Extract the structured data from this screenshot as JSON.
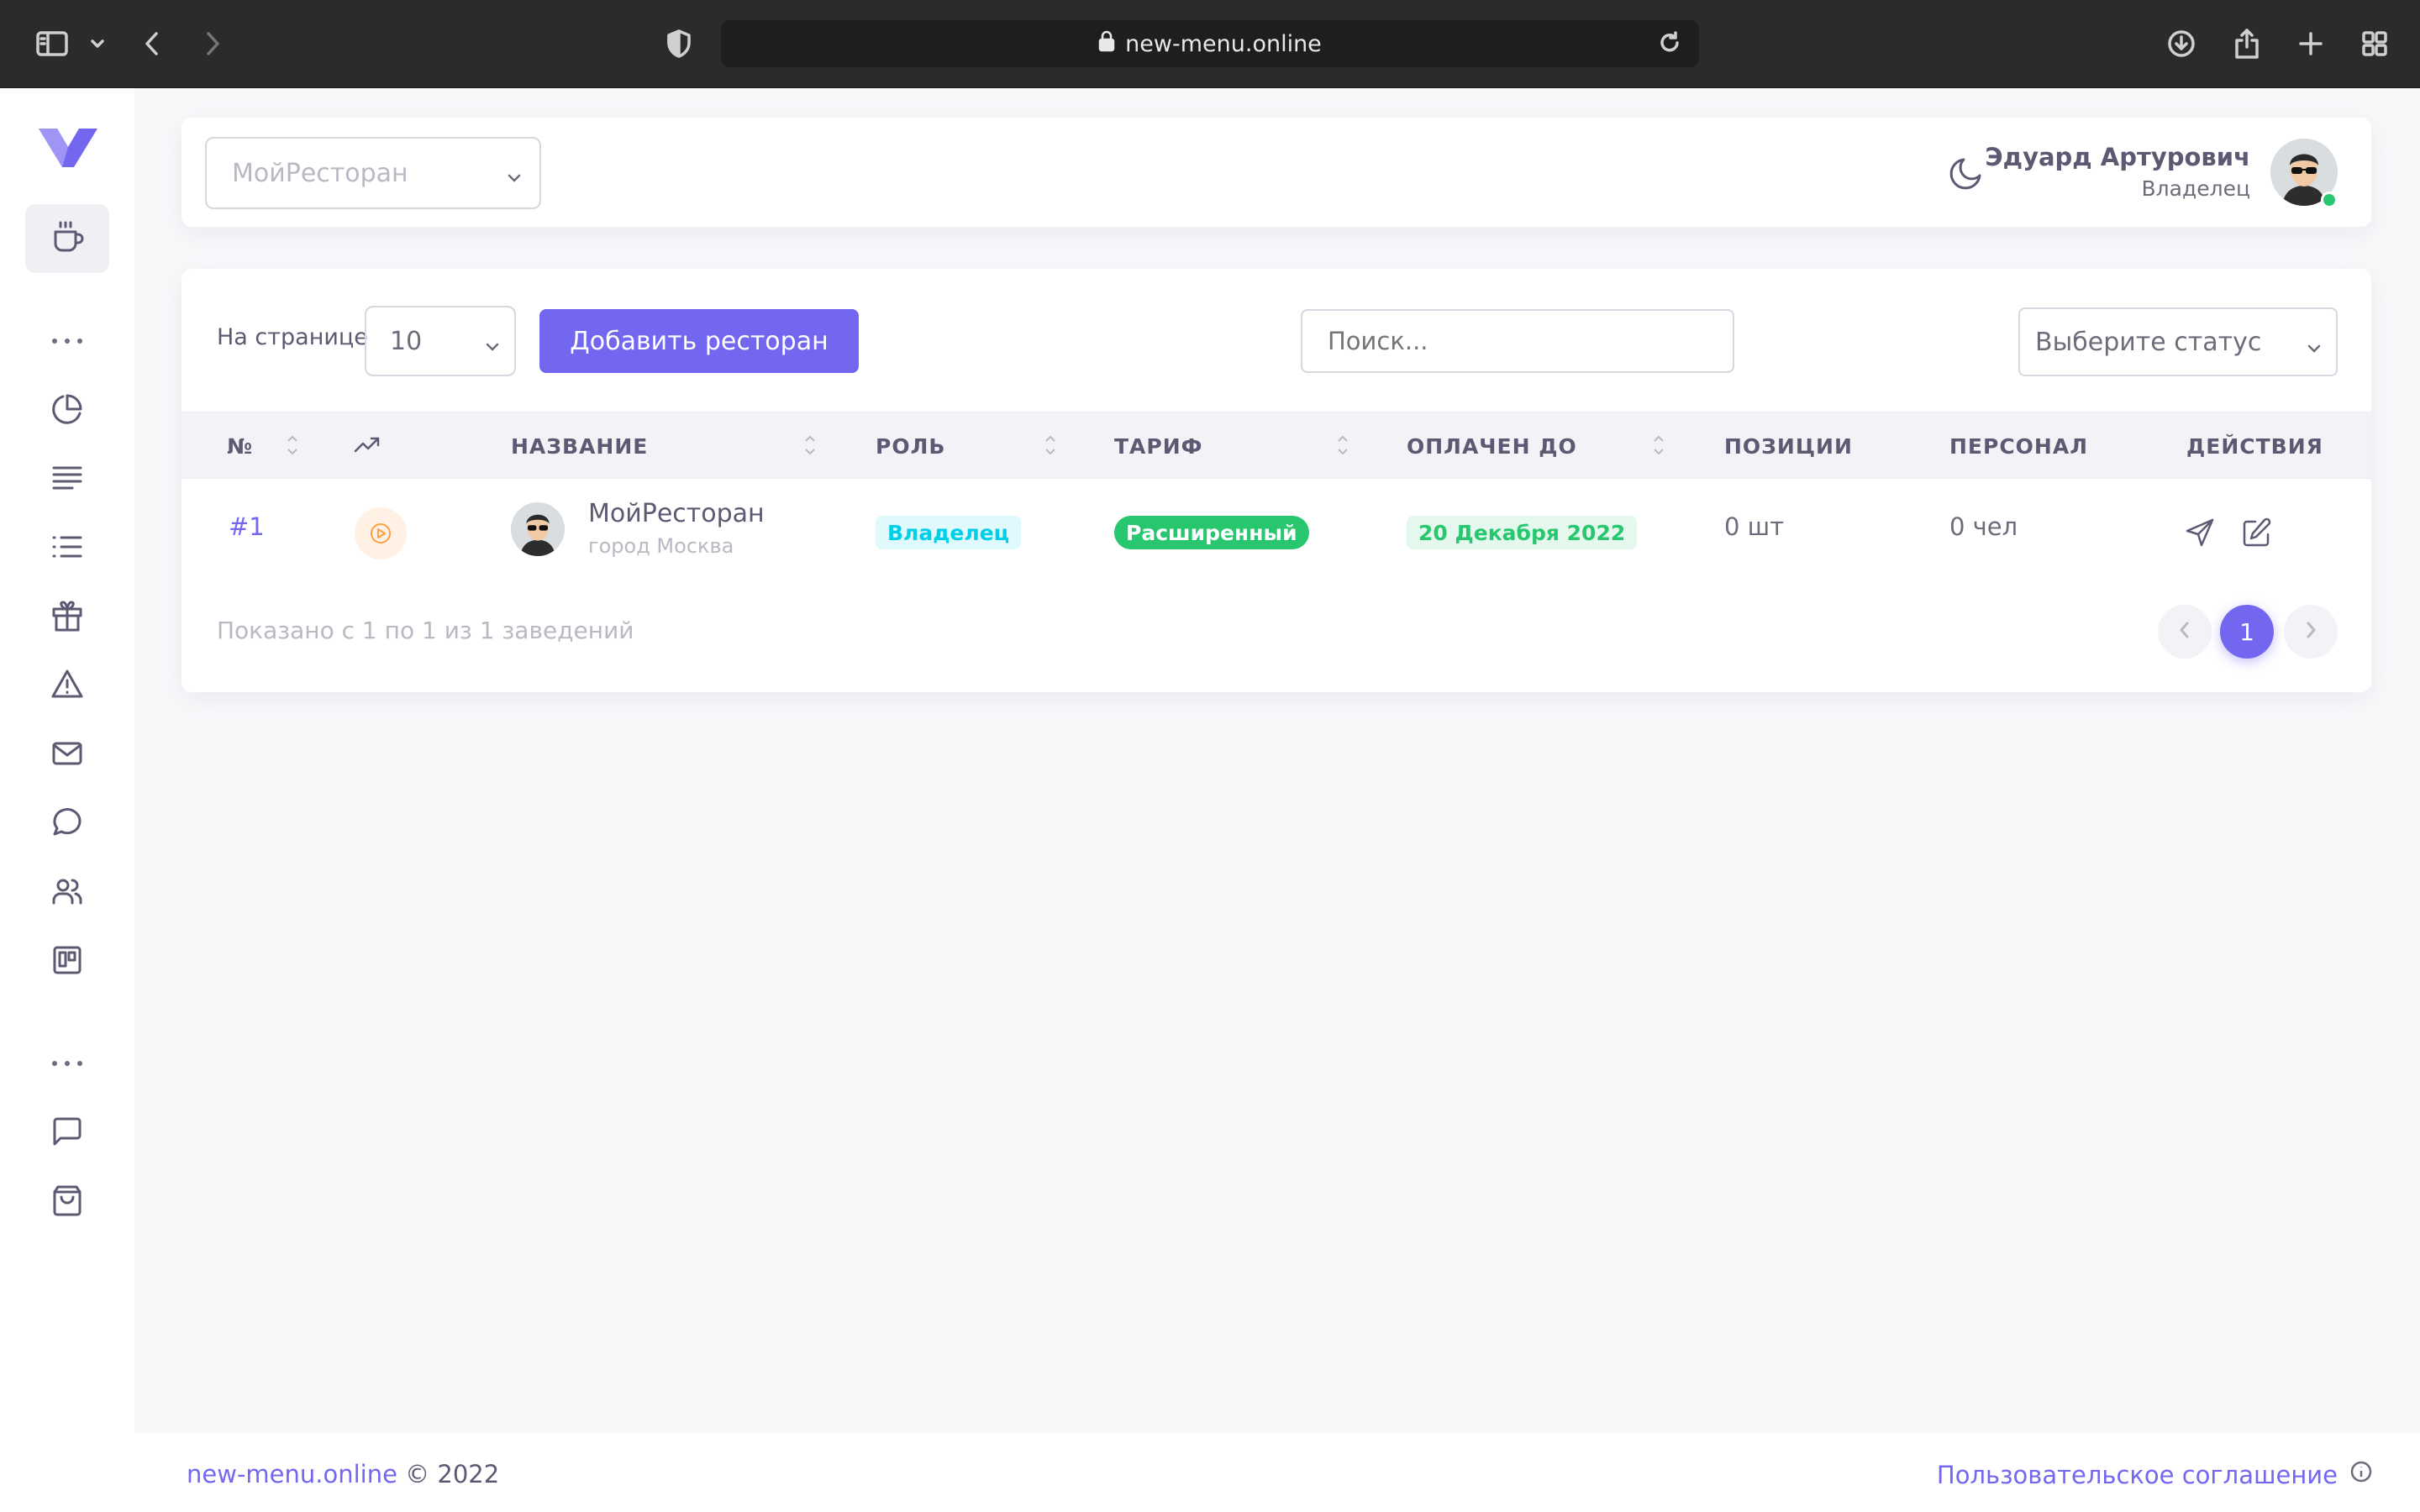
{
  "browser": {
    "url": "new-menu.online"
  },
  "header": {
    "restaurant_select": "МойРесторан",
    "user_name": "Эдуард Артурович",
    "user_role": "Владелец"
  },
  "toolbar": {
    "per_page_label": "На странице",
    "per_page_value": "10",
    "add_button": "Добавить ресторан",
    "search_placeholder": "Поиск...",
    "status_placeholder": "Выберите статус"
  },
  "table": {
    "columns": {
      "num": "№",
      "name": "НАЗВАНИЕ",
      "role": "РОЛЬ",
      "tariff": "ТАРИФ",
      "paid": "ОПЛАЧЕН ДО",
      "positions": "ПОЗИЦИИ",
      "staff": "ПЕРСОНАЛ",
      "actions": "ДЕЙСТВИЯ"
    },
    "rows": [
      {
        "id": "#1",
        "name": "МойРесторан",
        "city": "город Москва",
        "role": "Владелец",
        "tariff": "Расширенный",
        "paid_until": "20 Декабря 2022",
        "positions": "0 шт",
        "staff": "0 чел"
      }
    ]
  },
  "pagination": {
    "summary": "Показано с 1 по 1 из 1 заведений",
    "current_page": "1"
  },
  "footer": {
    "site": "new-menu.online",
    "copyright": "© 2022",
    "agreement": "Пользовательское соглашение"
  },
  "colors": {
    "accent": "#7367f0",
    "success": "#28c76f",
    "info": "#00cfe8",
    "warning": "#ff9f43"
  },
  "icons": [
    "sidebar-toggle-icon",
    "back-icon",
    "forward-icon",
    "shield-icon",
    "lock-icon",
    "reload-icon",
    "download-icon",
    "share-icon",
    "plus-icon",
    "tabs-grid-icon",
    "logo-icon",
    "cup-icon",
    "pie-chart-icon",
    "align-left-icon",
    "list-icon",
    "gift-icon",
    "alert-triangle-icon",
    "mail-icon",
    "message-circle-icon",
    "users-icon",
    "trello-icon",
    "message-square-icon",
    "shopping-bag-icon",
    "moon-icon",
    "trending-up-icon",
    "play-circle-icon",
    "send-icon",
    "edit-icon",
    "info-icon"
  ]
}
